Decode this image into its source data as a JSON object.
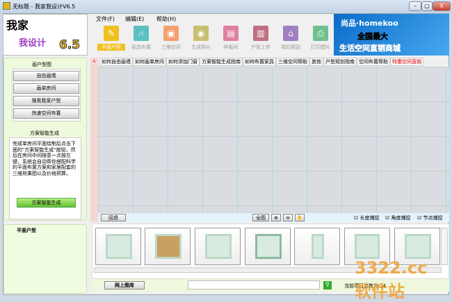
{
  "window": {
    "title": "无标题 - 我家我设计V6.5",
    "min": "–",
    "max": "▢",
    "close": "X"
  },
  "logo": {
    "line1": "我家",
    "line2": "我设计",
    "version": "6.5"
  },
  "menu": [
    "文件(F)",
    "编辑(E)",
    "帮助(H)"
  ],
  "toolbar": [
    {
      "label": "平面户型",
      "icon": "pencil-icon",
      "color": "#f0c020",
      "glyph": "✎"
    },
    {
      "label": "家具布置",
      "icon": "chair-icon",
      "color": "#5cc0c0",
      "glyph": "⑁"
    },
    {
      "label": "三维空间",
      "icon": "cube-icon",
      "color": "#f4a070",
      "glyph": "▣"
    },
    {
      "label": "生成照片",
      "icon": "camera-icon",
      "color": "#c8c070",
      "glyph": "◉"
    },
    {
      "label": "样板间",
      "icon": "sofa-icon",
      "color": "#e080a0",
      "glyph": "▤"
    },
    {
      "label": "户型上传",
      "icon": "disk-icon",
      "color": "#c07080",
      "glyph": "▥"
    },
    {
      "label": "我的家园",
      "icon": "house-icon",
      "color": "#a080c0",
      "glyph": "⌂"
    },
    {
      "label": "打印图片",
      "icon": "printer-icon",
      "color": "#70c090",
      "glyph": "⎙"
    }
  ],
  "banner": {
    "brand": "尚品·homekoo",
    "line2": "全国最大",
    "line3": "生活空间直销商城"
  },
  "tabs": [
    "如何自由画墙",
    "如何画单房间",
    "如何添加门窗",
    "方案智能生成指南",
    "如何布置家具",
    "三维空间帮助",
    "其他",
    "户型规划指南",
    "空间布置帮助",
    "特惠空间直销"
  ],
  "accent_red": "#e00000",
  "left": {
    "section1": "画户型图",
    "buttons": [
      "自由画墙",
      "画单房间",
      "搜索我家户型",
      "快速空间布置"
    ],
    "section2": "方案智能生成",
    "description": "完成单房间平面绘制后点击下面的\"方案智能生成\"按钮，然后在房间中间随意一点按左键，系统会自动帮你搭配科学的平面布置方案和家居配套的三维效果图以及价格预算。",
    "generate": "方案智能生成",
    "tree_item": "平面户型"
  },
  "bottombar": {
    "back": "回退",
    "fit": "全图",
    "checks": [
      "长度捕捉",
      "角度捕捉",
      "节点捕捉"
    ]
  },
  "library": {
    "online": "网上图库",
    "status": "当前项目总数为 14",
    "watermark": "3322.cc 软件站"
  }
}
